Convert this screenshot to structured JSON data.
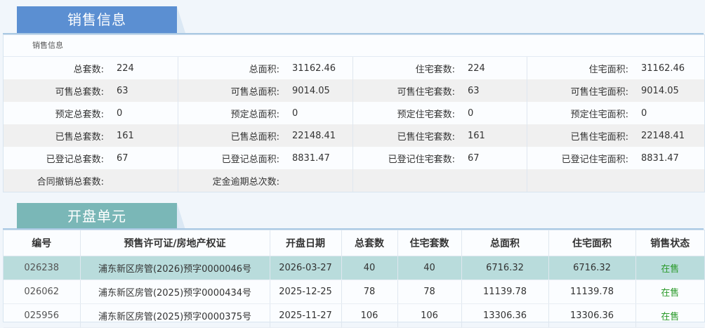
{
  "sales_info": {
    "tab_title": "销售信息",
    "subtitle": "销售信息",
    "rows": [
      [
        {
          "label": "总套数:",
          "value": "224"
        },
        {
          "label": "总面积:",
          "value": "31162.46"
        },
        {
          "label": "住宅套数:",
          "value": "224"
        },
        {
          "label": "住宅面积:",
          "value": "31162.46"
        }
      ],
      [
        {
          "label": "可售总套数:",
          "value": "63"
        },
        {
          "label": "可售总面积:",
          "value": "9014.05"
        },
        {
          "label": "可售住宅套数:",
          "value": "63"
        },
        {
          "label": "可售住宅面积:",
          "value": "9014.05"
        }
      ],
      [
        {
          "label": "预定总套数:",
          "value": "0"
        },
        {
          "label": "预定总面积:",
          "value": "0"
        },
        {
          "label": "预定住宅套数:",
          "value": "0"
        },
        {
          "label": "预定住宅面积:",
          "value": "0"
        }
      ],
      [
        {
          "label": "已售总套数:",
          "value": "161"
        },
        {
          "label": "已售总面积:",
          "value": "22148.41"
        },
        {
          "label": "已售住宅套数:",
          "value": "161"
        },
        {
          "label": "已售住宅面积:",
          "value": "22148.41"
        }
      ],
      [
        {
          "label": "已登记总套数:",
          "value": "67"
        },
        {
          "label": "已登记总面积:",
          "value": "8831.47"
        },
        {
          "label": "已登记住宅套数:",
          "value": "67"
        },
        {
          "label": "已登记住宅面积:",
          "value": "8831.47"
        }
      ],
      [
        {
          "label": "合同撤销总套数:",
          "value": ""
        },
        {
          "label": "定金逾期总次数:",
          "value": ""
        },
        {
          "label": "",
          "value": ""
        },
        {
          "label": "",
          "value": ""
        }
      ]
    ]
  },
  "units": {
    "tab_title": "开盘单元",
    "headers": [
      "编号",
      "预售许可证/房地产权证",
      "开盘日期",
      "总套数",
      "住宅套数",
      "总面积",
      "住宅面积",
      "销售状态"
    ],
    "rows": [
      [
        "026238",
        "浦东新区房管(2026)预字0000046号",
        "2026-03-27",
        "40",
        "40",
        "6716.32",
        "6716.32",
        "在售"
      ],
      [
        "026062",
        "浦东新区房管(2025)预字0000434号",
        "2025-12-25",
        "78",
        "78",
        "11139.78",
        "11139.78",
        "在售"
      ],
      [
        "025956",
        "浦东新区房管(2025)预字0000375号",
        "2025-11-27",
        "106",
        "106",
        "13306.36",
        "13306.36",
        "在售"
      ]
    ],
    "selected_row": 0
  },
  "colors": {
    "tab_sales": "#5b8fd2",
    "tab_units": "#7ab7b7",
    "selected_row": "#b9dcdc",
    "status_green": "#2a9a2a"
  }
}
